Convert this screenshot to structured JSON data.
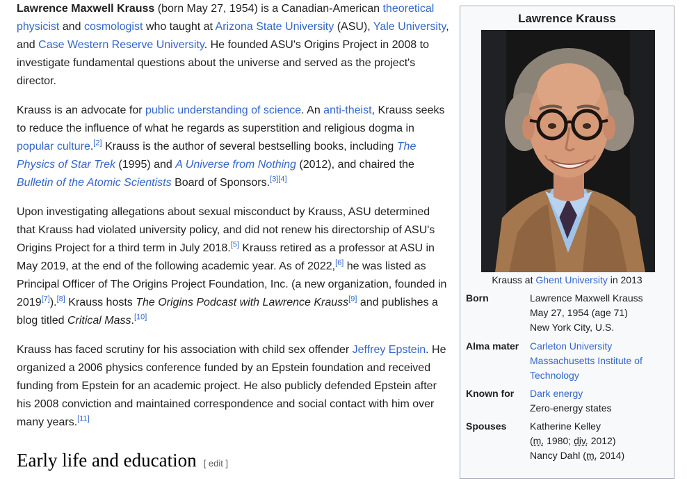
{
  "article": {
    "p1": {
      "name": "Lawrence Maxwell Krauss",
      "t1": " (born May 27, 1954) is a Canadian-American ",
      "l1": "theoretical physicist",
      "t2": " and ",
      "l2": "cosmologist",
      "t3": " who taught at ",
      "l3": "Arizona State University",
      "t4": " (ASU), ",
      "l4": "Yale University",
      "t5": ", and ",
      "l5": "Case Western Reserve University",
      "t6": ". He founded ASU's Origins Project in 2008 to investigate fundamental questions about the universe and served as the project's director."
    },
    "p2": {
      "t1": "Krauss is an advocate for ",
      "l1": "public understanding of science",
      "t2": ". An ",
      "l2": "anti-theist",
      "t3": ", Krauss seeks to reduce the influence of what he regards as superstition and religious dogma in ",
      "l3": "popular culture",
      "t4": ".",
      "r1": "[2]",
      "t5": " Krauss is the author of several bestselling books, including ",
      "l4": "The Physics of Star Trek",
      "t6": " (1995) and ",
      "l5": "A Universe from Nothing",
      "t7": " (2012), and chaired the ",
      "l6": "Bulletin of the Atomic Scientists",
      "t8": " Board of Sponsors.",
      "r2": "[3]",
      "r3": "[4]"
    },
    "p3": {
      "t1": "Upon investigating allegations about sexual misconduct by Krauss, ASU determined that Krauss had violated university policy, and did not renew his directorship of ASU's Origins Project for a third term in July 2018.",
      "r1": "[5]",
      "t2": " Krauss retired as a professor at ASU in May 2019, at the end of the following academic year. As of 2022,",
      "r2": "[6]",
      "t3": " he was listed as Principal Officer of The Origins Project Foundation, Inc. (a new organization, founded in 2019",
      "r3": "[7]",
      "t4": ").",
      "r4": "[8]",
      "t5": " Krauss hosts ",
      "i1": "The Origins Podcast with Lawrence Krauss",
      "r5": "[9]",
      "t6": " and publishes a blog titled ",
      "i2": "Critical Mass",
      "t7": ".",
      "r6": "[10]"
    },
    "p4": {
      "t1": "Krauss has faced scrutiny for his association with child sex offender ",
      "l1": "Jeffrey Epstein",
      "t2": ". He organized a 2006 physics conference funded by an Epstein foundation and received funding from Epstein for an academic project. He also publicly defended Epstein after his 2008 conviction and maintained correspondence and social contact with him over many years.",
      "r1": "[11]"
    },
    "heading": "Early life and education",
    "edit": "[ edit ]"
  },
  "infobox": {
    "title": "Lawrence Krauss",
    "caption_pre": "Krauss at ",
    "caption_link": "Ghent University",
    "caption_post": " in 2013",
    "born_label": "Born",
    "born_name": "Lawrence Maxwell Krauss",
    "born_date": "May 27, 1954 (age 71)",
    "born_place": "New York City, U.S.",
    "alma_label": "Alma mater",
    "alma_1": "Carleton University",
    "alma_2a": "Massachusetts Institute of",
    "alma_2b": "Technology",
    "known_label": "Known for",
    "known_1": "Dark energy",
    "known_2": "Zero-energy states",
    "spouses_label": "Spouses",
    "spouse_1": "Katherine Kelley",
    "spouse_1_m": "m.",
    "spouse_1_my": " 1980; ",
    "spouse_1_d": "div.",
    "spouse_1_dy": " 2012",
    "spouse_2": "Nancy Dahl",
    "spouse_2_m": "m.",
    "spouse_2_y": " 2014"
  },
  "colors": {
    "link": "#3366cc",
    "text": "#202122",
    "infobox_bg": "#f8f9fa",
    "infobox_border": "#a2a9b1"
  }
}
